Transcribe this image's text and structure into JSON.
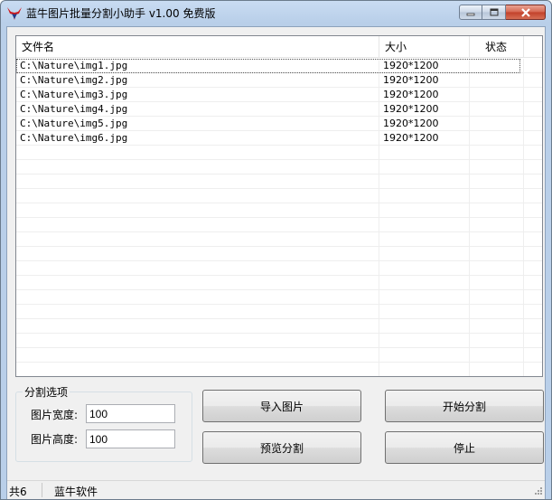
{
  "window": {
    "title": "蓝牛图片批量分割小助手 v1.00 免费版"
  },
  "list": {
    "columns": [
      "文件名",
      "大小",
      "状态"
    ],
    "rows": [
      {
        "path": "C:\\Nature\\img1.jpg",
        "size": "1920*1200",
        "status": ""
      },
      {
        "path": "C:\\Nature\\img2.jpg",
        "size": "1920*1200",
        "status": ""
      },
      {
        "path": "C:\\Nature\\img3.jpg",
        "size": "1920*1200",
        "status": ""
      },
      {
        "path": "C:\\Nature\\img4.jpg",
        "size": "1920*1200",
        "status": ""
      },
      {
        "path": "C:\\Nature\\img5.jpg",
        "size": "1920*1200",
        "status": ""
      },
      {
        "path": "C:\\Nature\\img6.jpg",
        "size": "1920*1200",
        "status": ""
      }
    ]
  },
  "options": {
    "legend": "分割选项",
    "width_label": "图片宽度:",
    "width_value": "100",
    "height_label": "图片高度:",
    "height_value": "100"
  },
  "buttons": {
    "import": "导入图片",
    "start": "开始分割",
    "preview": "预览分割",
    "stop": "停止"
  },
  "status": {
    "count": "共6",
    "brand": "蓝牛软件"
  },
  "icons": {
    "app": "bull-logo-icon",
    "minimize": "minimize-icon",
    "maximize": "maximize-icon",
    "close": "close-icon",
    "grip": "resize-grip-icon"
  },
  "colors": {
    "title_bar": "#b9cfe9",
    "close_button": "#c1402a",
    "logo_red": "#d0191c",
    "logo_blue": "#1f3e8e"
  }
}
